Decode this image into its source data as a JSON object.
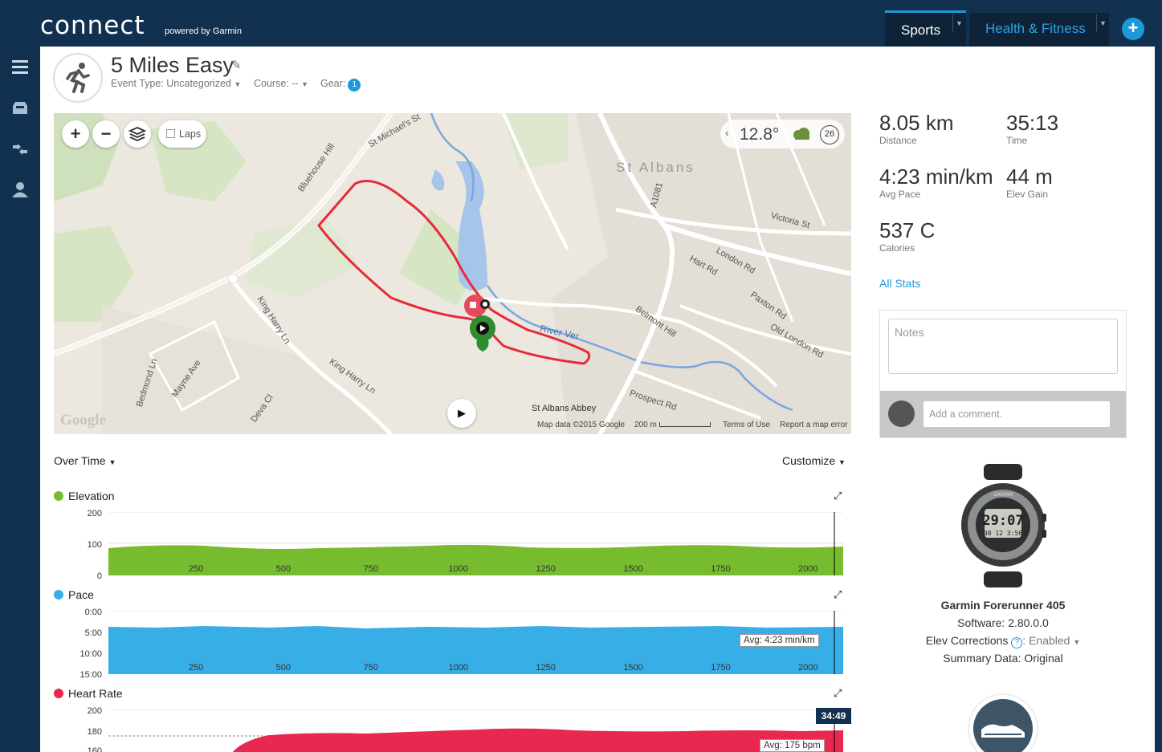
{
  "app": {
    "logo": "connect",
    "logo_sub": "powered by Garmin",
    "tabs": [
      {
        "label": "Sports"
      },
      {
        "label": "Health & Fitness"
      }
    ],
    "add_label": "+"
  },
  "activity": {
    "title": "5 Miles Easy",
    "event_type": "Event Type: Uncategorized",
    "course": "Course: --",
    "gear_label": "Gear:",
    "gear_count": "1"
  },
  "map": {
    "laps_label": "Laps",
    "temperature": "12.8°",
    "wind": "26",
    "labels": {
      "st_albans": "St Albans",
      "victoria_st": "Victoria St",
      "london_rd": "London Rd",
      "river_ver": "River Ver",
      "prospect_rd": "Prospect Rd",
      "king_harry_ln": "King Harry Ln",
      "king_harry_ln2": "King Harry Ln",
      "bluehouse_hill": "Bluehouse Hill",
      "st_michaels": "St Michael's St",
      "a1081": "A1081",
      "st_albans_abbey": "St Albans Abbey",
      "belmont_hill": "Belmont Hill",
      "hart_rd": "Hart Rd",
      "paxton_rd": "Paxton Rd",
      "old_london_rd": "Old London Rd",
      "bedmond_ln": "Bedmond Ln",
      "mayne_ave": "Mayne Ave",
      "deva_cl": "Deva Cl"
    },
    "google": "Google",
    "map_data": "Map data ©2015 Google",
    "scale": "200 m",
    "terms": "Terms of Use",
    "report": "Report a map error"
  },
  "charts": {
    "over_time": "Over Time",
    "customize": "Customize",
    "elevation": {
      "title": "Elevation",
      "y_ticks": [
        "200",
        "100",
        "0"
      ]
    },
    "pace": {
      "title": "Pace",
      "y_ticks": [
        "0:00",
        "5:00",
        "10:00",
        "15:00"
      ],
      "avg": "Avg: 4:23 min/km"
    },
    "heart_rate": {
      "title": "Heart Rate",
      "y_ticks": [
        "200",
        "180",
        "160"
      ],
      "avg": "Avg: 175 bpm"
    },
    "x_ticks": [
      "250",
      "500",
      "750",
      "1000",
      "1250",
      "1500",
      "1750",
      "2000"
    ],
    "cursor_time": "34:49",
    "colors": {
      "elevation": "#76bc2e",
      "pace": "#37aee6",
      "heart_rate": "#e8284e"
    }
  },
  "chart_data": [
    {
      "type": "area",
      "title": "Elevation",
      "x": [
        0,
        250,
        500,
        750,
        1000,
        1250,
        1500,
        1750,
        2000,
        2100
      ],
      "values": [
        88,
        85,
        82,
        80,
        86,
        80,
        82,
        88,
        80,
        80
      ],
      "ylim": [
        0,
        200
      ]
    },
    {
      "type": "area",
      "title": "Pace",
      "x": [
        0,
        2100
      ],
      "values": [
        4.4,
        4.4
      ],
      "ylim": [
        0,
        15
      ]
    },
    {
      "type": "area",
      "title": "Heart Rate",
      "x": [
        0,
        250,
        500,
        750,
        1000,
        1250,
        1500,
        1750,
        2000,
        2100
      ],
      "values": [
        150,
        172,
        175,
        176,
        177,
        175,
        176,
        177,
        176,
        176
      ],
      "ylim": [
        160,
        200
      ]
    }
  ],
  "stats": {
    "distance": {
      "value": "8.05 km",
      "label": "Distance"
    },
    "time": {
      "value": "35:13",
      "label": "Time"
    },
    "avg_pace": {
      "value": "4:23 min/km",
      "label": "Avg Pace"
    },
    "elev_gain": {
      "value": "44 m",
      "label": "Elev Gain"
    },
    "calories": {
      "value": "537 C",
      "label": "Calories"
    },
    "all_stats": "All Stats"
  },
  "notes": {
    "placeholder": "Notes",
    "comment_placeholder": "Add a comment."
  },
  "device": {
    "name": "Garmin Forerunner 405",
    "software": "Software: 2.80.0.0",
    "elev_label": "Elev Corrections",
    "elev_value": ": Enabled",
    "summary": "Summary Data: Original",
    "watch_screen_1": "29:07",
    "watch_screen_2": "08 12 3:56",
    "watch_brand": "GARMIN"
  }
}
